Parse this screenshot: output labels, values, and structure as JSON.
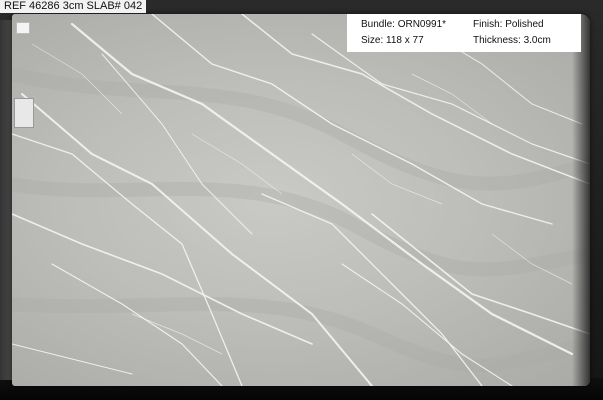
{
  "photo": {
    "ref_label": "REF 46286 3cm  SLAB# 042"
  },
  "info": {
    "bundle": "Bundle: ORN0991*",
    "finish": "Finish: Polished",
    "size": "Size: 118 x 77",
    "thickness": "Thickness: 3.0cm"
  },
  "colors": {
    "slab_base": "#c4c4c1",
    "vein": "#f2f2f0",
    "background": "#1f1f1f"
  }
}
